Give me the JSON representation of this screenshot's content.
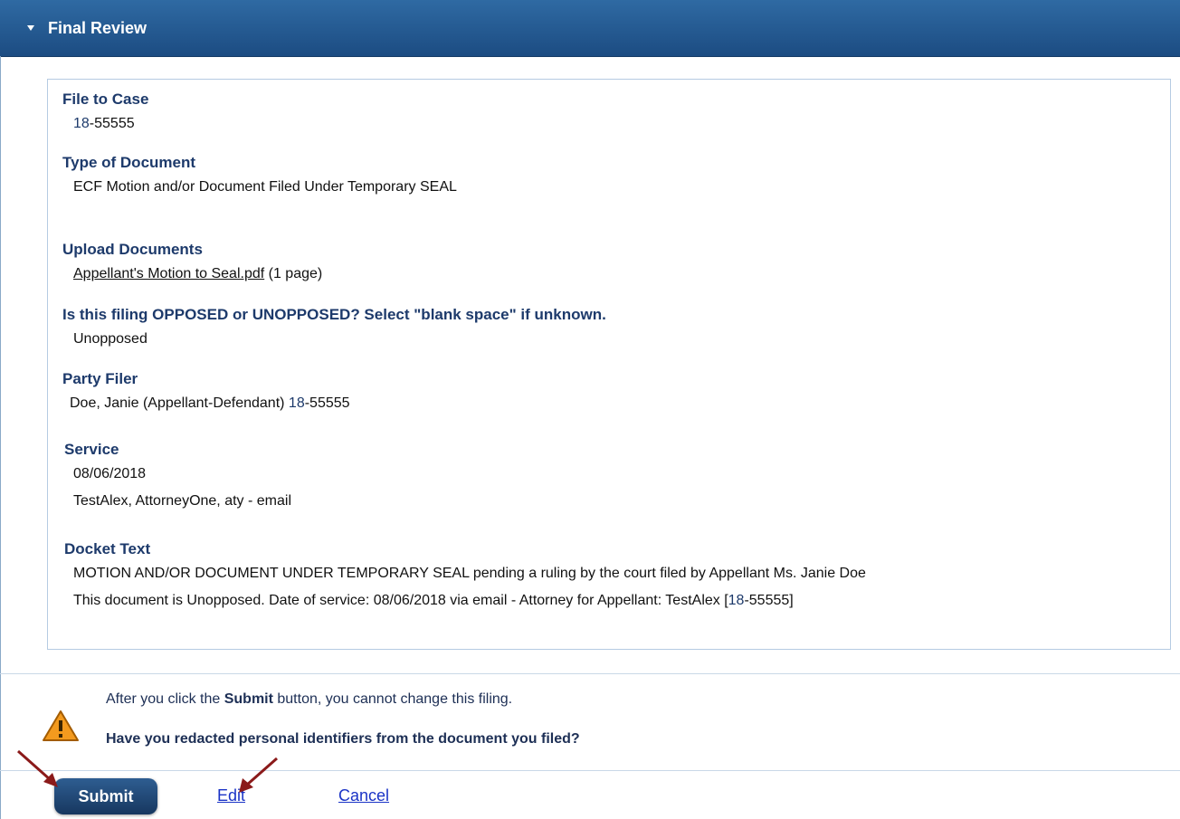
{
  "header": {
    "title": "Final Review"
  },
  "review": {
    "file_to_case": {
      "label": "File to Case",
      "case_prefix": "18",
      "case_rest": "-55555"
    },
    "type_of_document": {
      "label": "Type of Document",
      "value": "ECF Motion and/or Document Filed Under Temporary SEAL"
    },
    "upload_documents": {
      "label": "Upload Documents",
      "file_link": "Appellant's Motion to Seal.pdf",
      "pages": " (1 page)"
    },
    "opposed": {
      "label": "Is this filing OPPOSED or UNOPPOSED? Select \"blank space\" if unknown.",
      "value": "Unopposed"
    },
    "party_filer": {
      "label": "Party Filer",
      "value_prefix": "Doe, Janie (Appellant-Defendant) ",
      "case_prefix": "18",
      "case_rest": "-55555"
    },
    "service": {
      "label": "Service",
      "date": "08/06/2018",
      "detail": "TestAlex, AttorneyOne, aty - email"
    },
    "docket_text": {
      "label": "Docket Text",
      "line1": "MOTION AND/OR DOCUMENT UNDER TEMPORARY SEAL pending a ruling by the court filed by Appellant Ms. Janie Doe",
      "line2_prefix": "This document is Unopposed. Date of service: 08/06/2018 via email - Attorney for Appellant: TestAlex [",
      "case_prefix": "18",
      "case_rest": "-55555]"
    }
  },
  "notice": {
    "line1_before": "After you click the ",
    "line1_bold": "Submit",
    "line1_after": " button, you cannot change this filing.",
    "question": "Have you redacted personal identifiers from the document you filed?"
  },
  "actions": {
    "submit": "Submit",
    "edit": "Edit",
    "cancel": "Cancel"
  }
}
